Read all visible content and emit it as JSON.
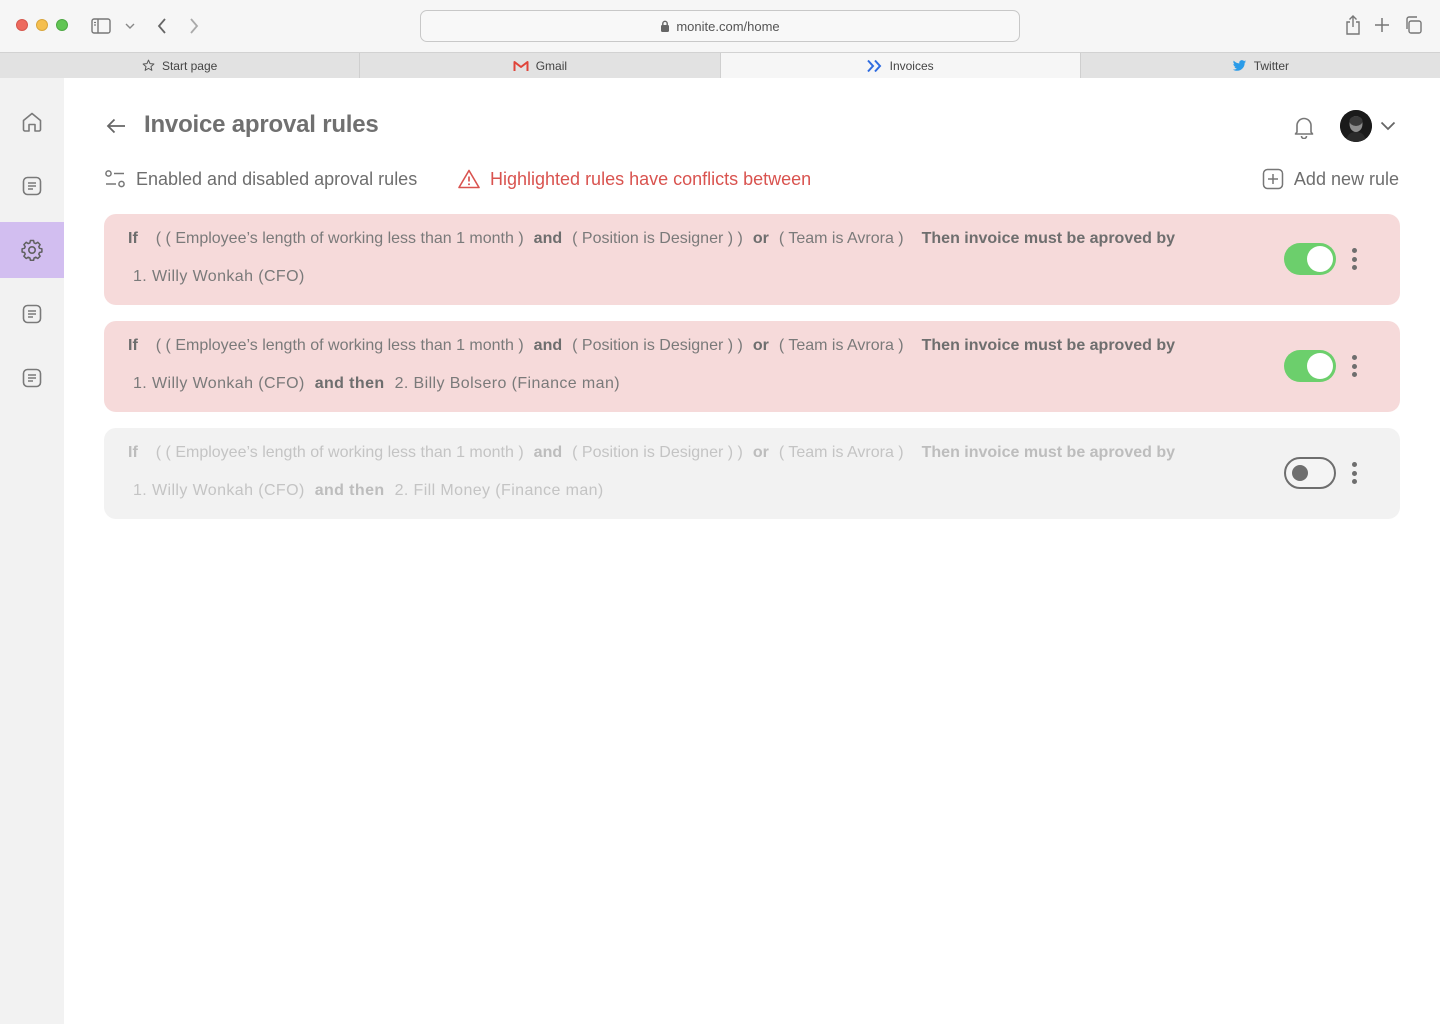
{
  "browser": {
    "url": "monite.com/home",
    "tabs": [
      {
        "label": "Start page",
        "icon": "star-icon"
      },
      {
        "label": "Gmail",
        "icon": "gmail-icon"
      },
      {
        "label": "Invoices",
        "icon": "monite-icon",
        "active": true
      },
      {
        "label": "Twitter",
        "icon": "twitter-icon"
      }
    ]
  },
  "sidebar": {
    "items": [
      {
        "icon": "home-icon"
      },
      {
        "icon": "document-icon"
      },
      {
        "icon": "gear-icon",
        "active": true
      },
      {
        "icon": "document-icon"
      },
      {
        "icon": "document-icon"
      }
    ],
    "active_color": "#d2bef0"
  },
  "header": {
    "title": "Invoice aproval rules"
  },
  "toolbar": {
    "filter_label": "Enabled and disabled aproval rules",
    "conflict_label": "Highlighted rules have conflicts between",
    "add_label": "Add new rule"
  },
  "colors": {
    "conflict_text": "#d9534f",
    "conflict_card": "#f6dada",
    "disabled_card": "#f2f2f2",
    "toggle_on": "#6ccf6c"
  },
  "rules": [
    {
      "state": "conflict",
      "enabled": true,
      "if": "If",
      "cond1": "( ( Employee’s length of working less than 1 month )",
      "op1": "and",
      "cond2": "( Position is Designer ) )",
      "op2": "or",
      "cond3": "( Team is Avrora )",
      "then": "Then invoice must be aproved by",
      "approver1": "1. Willy Wonkah (CFO)",
      "join": "",
      "approver2": ""
    },
    {
      "state": "conflict",
      "enabled": true,
      "if": "If",
      "cond1": "( ( Employee’s length of working less than 1 month )",
      "op1": "and",
      "cond2": "( Position is Designer ) )",
      "op2": "or",
      "cond3": "( Team is Avrora )",
      "then": "Then invoice must be aproved by",
      "approver1": "1. Willy Wonkah (CFO)",
      "join": "and then",
      "approver2": "2. Billy Bolsero (Finance man)"
    },
    {
      "state": "disabled",
      "enabled": false,
      "if": "If",
      "cond1": "( ( Employee’s length of working less than 1 month )",
      "op1": "and",
      "cond2": "( Position is Designer ) )",
      "op2": "or",
      "cond3": "( Team is Avrora )",
      "then": "Then invoice must be aproved by",
      "approver1": "1. Willy Wonkah (CFO)",
      "join": "and then",
      "approver2": "2. Fill Money (Finance man)"
    }
  ]
}
